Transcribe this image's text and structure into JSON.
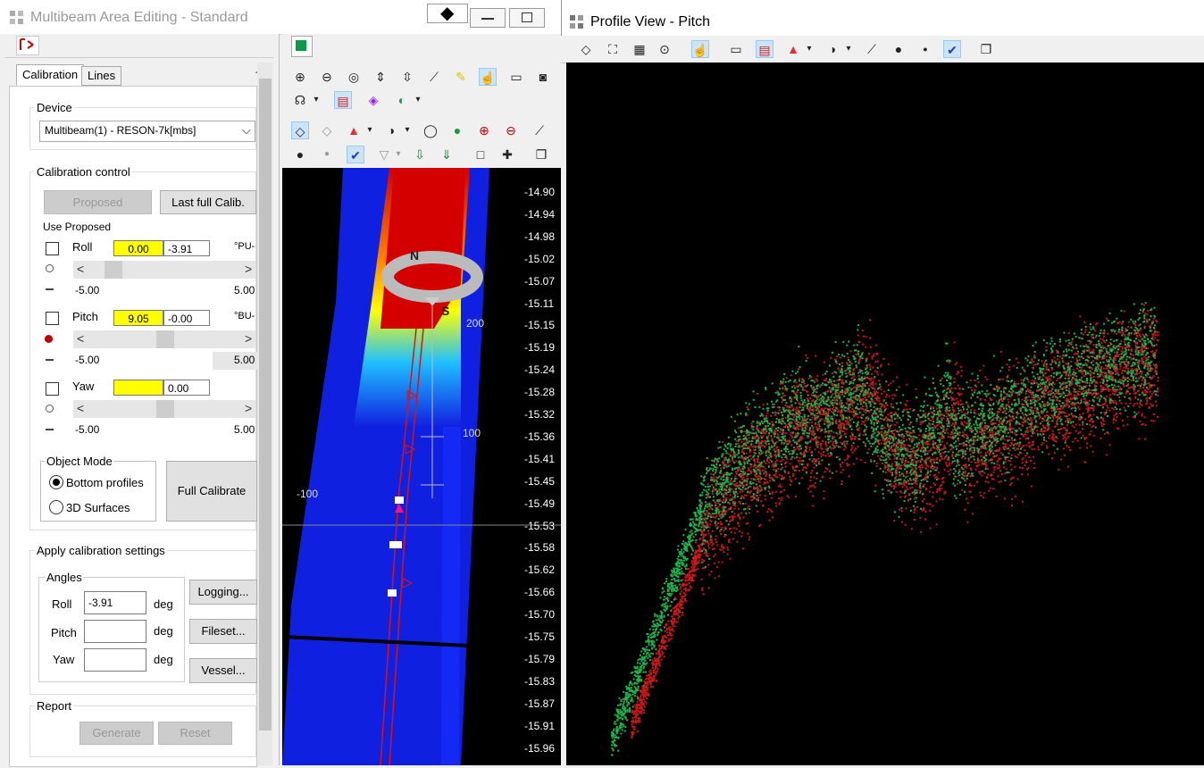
{
  "main_window": {
    "title": "Multibeam Area Editing - Standard",
    "toolbar_icon": "map-view-icon"
  },
  "tabs": [
    {
      "label": "Calibration"
    },
    {
      "label": "Lines"
    }
  ],
  "device": {
    "label": "Device",
    "value": "Multibeam(1) - RESON-7k[mbs]"
  },
  "calibration_control": {
    "label": "Calibration control",
    "proposed": "Proposed",
    "last_full": "Last full Calib.",
    "use_proposed": "Use Proposed",
    "roll": {
      "label": "Roll",
      "proposed": "0.00",
      "current": "-3.91",
      "unit": "°PU-",
      "min": "-5.00",
      "max": "5.00"
    },
    "pitch": {
      "label": "Pitch",
      "proposed": "9.05",
      "current": "-0.00",
      "unit": "°BU-",
      "min": "-5.00",
      "max": "5.00"
    },
    "yaw": {
      "label": "Yaw",
      "proposed": "",
      "current": "0.00",
      "unit": "",
      "min": "-5.00",
      "max": "5.00"
    }
  },
  "object_mode": {
    "label": "Object Mode",
    "options": [
      "Bottom profiles",
      "3D Surfaces"
    ],
    "selected": "Bottom profiles"
  },
  "full_calibrate": "Full Calibrate",
  "apply": {
    "label": "Apply calibration settings",
    "angles": "Angles",
    "roll": {
      "label": "Roll",
      "value": "-3.91"
    },
    "pitch": {
      "label": "Pitch",
      "value": ""
    },
    "yaw": {
      "label": "Yaw",
      "value": ""
    },
    "unit": "deg",
    "logging": "Logging...",
    "fileset": "Fileset...",
    "vessel": "Vessel..."
  },
  "report": {
    "label": "Report",
    "generate": "Generate",
    "reset": "Reset"
  },
  "view3d": {
    "depth_labels": [
      "-14.90",
      "-14.94",
      "-14.98",
      "-15.02",
      "-15.07",
      "-15.11",
      "-15.15",
      "-15.19",
      "-15.24",
      "-15.28",
      "-15.32",
      "-15.36",
      "-15.41",
      "-15.45",
      "-15.49",
      "-15.53",
      "-15.58",
      "-15.62",
      "-15.66",
      "-15.70",
      "-15.75",
      "-15.79",
      "-15.83",
      "-15.87",
      "-15.91",
      "-15.96"
    ],
    "grid_labels": [
      "200",
      "100",
      "-100"
    ],
    "compass": [
      "N",
      "S"
    ]
  },
  "profile_window": {
    "title": "Profile View - Pitch"
  },
  "colors": {
    "green": "#22b14c",
    "red": "#c81818",
    "swath_blue": "#1020e0",
    "highlight_yellow": "#ffff00"
  }
}
